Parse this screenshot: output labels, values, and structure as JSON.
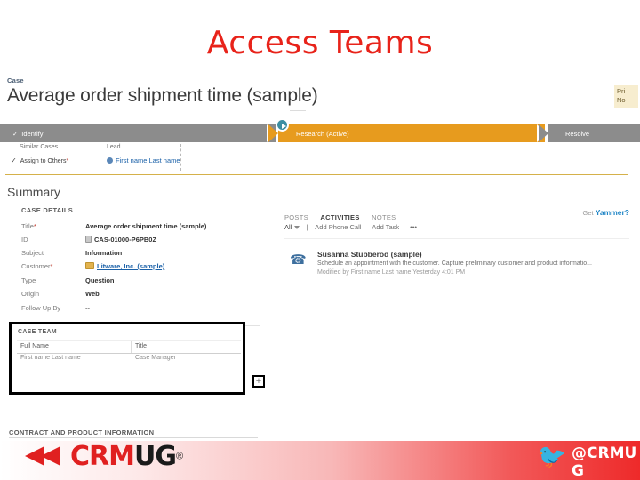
{
  "slide": {
    "title": "Access Teams",
    "title_color": "#e8231a"
  },
  "record": {
    "entity_label": "Case",
    "title": "Average order shipment time (sample)",
    "header_right": {
      "line1": "Pri",
      "line2": "No"
    }
  },
  "process": {
    "stages": [
      {
        "label": "Identify",
        "state": "completed",
        "check": "✓"
      },
      {
        "label": "Research (Active)",
        "state": "active"
      },
      {
        "label": "Resolve",
        "state": "future"
      }
    ],
    "fields": [
      {
        "label": "Similar Cases",
        "value": ""
      },
      {
        "label": "Assign to Others",
        "required": "*",
        "check": "✓"
      },
      {
        "label": "Lead",
        "value": "First name Last name",
        "is_link": true
      }
    ]
  },
  "summary": {
    "heading": "Summary",
    "case_details_heading": "CASE DETAILS",
    "fields": [
      {
        "label": "Title",
        "required": "*",
        "value": "Average order shipment time (sample)"
      },
      {
        "label": "ID",
        "value": "CAS-01000-P6PB0Z",
        "icon": "lock-icon"
      },
      {
        "label": "Subject",
        "value": "Information"
      },
      {
        "label": "Customer",
        "required": "*",
        "value": "Litware, Inc. (sample)",
        "is_link": true,
        "icon": "account-icon"
      },
      {
        "label": "Type",
        "value": "Question"
      },
      {
        "label": "Origin",
        "value": "Web"
      },
      {
        "label": "Follow Up By",
        "value": "--"
      }
    ]
  },
  "case_team": {
    "heading": "CASE TEAM",
    "columns": [
      "Full Name",
      "Title"
    ],
    "rows": [
      {
        "full_name": "First name Last name",
        "title": "Case Manager"
      }
    ],
    "add_button_label": "+"
  },
  "contract_section": {
    "heading": "CONTRACT AND PRODUCT INFORMATION"
  },
  "social_pane": {
    "tabs": [
      {
        "label": "POSTS",
        "active": false
      },
      {
        "label": "ACTIVITIES",
        "active": true
      },
      {
        "label": "NOTES",
        "active": false
      }
    ],
    "yammer": {
      "prefix": "Get",
      "brand": "Yammer?"
    },
    "filter": "All",
    "actions": [
      "Add Phone Call",
      "Add Task",
      "•••"
    ],
    "activities": [
      {
        "icon": "phone-call-icon",
        "name": "Susanna Stubberod (sample)",
        "description": "Schedule an appointment with the customer. Capture preliminary customer and product informatio...",
        "meta": "Modified by First name Last name   Yesterday 4:01 PM"
      }
    ]
  },
  "footer": {
    "logo": {
      "crm": "CRM",
      "ug": "UG",
      "registered": "®"
    },
    "twitter": {
      "icon": "twitter-bird-icon",
      "handle": "@CRMUG"
    }
  }
}
